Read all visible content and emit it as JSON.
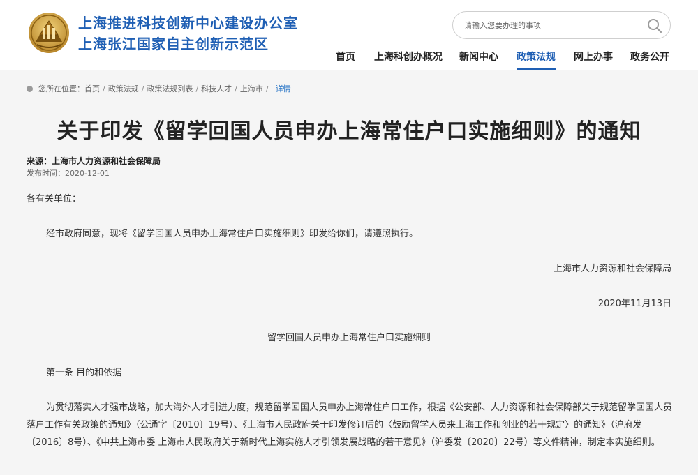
{
  "header": {
    "org_line1": "上海推进科技创新中心建设办公室",
    "org_line2": "上海张江国家自主创新示范区",
    "search_placeholder": "请输入您要办理的事项",
    "brand_color": "#1f5fb4",
    "search_icon": "search-icon",
    "nav": [
      {
        "label": "首页",
        "active": false
      },
      {
        "label": "上海科创办概况",
        "active": false
      },
      {
        "label": "新闻中心",
        "active": false
      },
      {
        "label": "政策法规",
        "active": true
      },
      {
        "label": "网上办事",
        "active": false
      },
      {
        "label": "政务公开",
        "active": false
      }
    ]
  },
  "breadcrumb": {
    "prefix": "您所在位置：",
    "items": [
      "首页",
      "政策法规",
      "政策法规列表",
      "科技人才",
      "上海市"
    ],
    "current": "详情"
  },
  "article": {
    "title": "关于印发《留学回国人员申办上海常住户口实施细则》的通知",
    "source": "来源：上海市人力资源和社会保障局",
    "publish_date": "发布时间：2020-12-01",
    "salutation": "各有关单位：",
    "intro": "经市政府同意，现将《留学回国人员申办上海常住户口实施细则》印发给你们，请遵照执行。",
    "issuer": "上海市人力资源和社会保障局",
    "issue_date": "2020年11月13日",
    "doc_title": "留学回国人员申办上海常住户口实施细则",
    "article1_heading": "第一条  目的和依据",
    "article1_body": "为贯彻落实人才强市战略，加大海外人才引进力度，规范留学回国人员申办上海常住户口工作，根据《公安部、人力资源和社会保障部关于规范留学回国人员落户工作有关政策的通知》（公通字〔2010〕19号）、《上海市人民政府关于印发修订后的〈鼓励留学人员来上海工作和创业的若干规定〉的通知》（沪府发〔2016〕8号）、《中共上海市委 上海市人民政府关于新时代上海实施人才引领发展战略的若干意见》（沪委发〔2020〕22号）等文件精神，制定本实施细则。"
  }
}
